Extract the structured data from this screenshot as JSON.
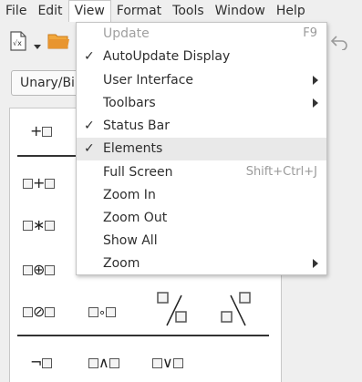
{
  "menubar": {
    "items": [
      {
        "label": "File"
      },
      {
        "label": "Edit"
      },
      {
        "label": "View"
      },
      {
        "label": "Format"
      },
      {
        "label": "Tools"
      },
      {
        "label": "Window"
      },
      {
        "label": "Help"
      }
    ]
  },
  "toolbar": {
    "icons": [
      "formula-document-icon",
      "dropdown-arrow-icon",
      "open-folder-icon",
      "undo-icon",
      "undo-dropdown-icon"
    ]
  },
  "elements_panel": {
    "category_combo_value": "Unary/Binary Operators",
    "symbols": {
      "unary_plus": "+",
      "plus": "+",
      "multiply": "∗",
      "circle_plus": "⊕",
      "circle_slash": "⊘",
      "ring": "∘",
      "not": "¬",
      "and": "∧",
      "or": "∨"
    }
  },
  "view_menu": {
    "items": [
      {
        "label": "Update",
        "shortcut": "F9",
        "checked": false,
        "enabled": false,
        "submenu": false
      },
      {
        "label": "AutoUpdate Display",
        "shortcut": "",
        "checked": true,
        "enabled": true,
        "submenu": false
      },
      {
        "label": "User Interface",
        "shortcut": "",
        "checked": false,
        "enabled": true,
        "submenu": true
      },
      {
        "label": "Toolbars",
        "shortcut": "",
        "checked": false,
        "enabled": true,
        "submenu": true
      },
      {
        "label": "Status Bar",
        "shortcut": "",
        "checked": true,
        "enabled": true,
        "submenu": false
      },
      {
        "label": "Elements",
        "shortcut": "",
        "checked": true,
        "enabled": true,
        "submenu": false,
        "highlighted": true
      },
      {
        "label": "Full Screen",
        "shortcut": "Shift+Ctrl+J",
        "checked": false,
        "enabled": true,
        "submenu": false
      },
      {
        "label": "Zoom In",
        "shortcut": "",
        "checked": false,
        "enabled": true,
        "submenu": false
      },
      {
        "label": "Zoom Out",
        "shortcut": "",
        "checked": false,
        "enabled": true,
        "submenu": false
      },
      {
        "label": "Show All",
        "shortcut": "",
        "checked": false,
        "enabled": true,
        "submenu": false
      },
      {
        "label": "Zoom",
        "shortcut": "",
        "checked": false,
        "enabled": true,
        "submenu": true
      }
    ],
    "check_glyph": "✓"
  },
  "colors": {
    "menu_highlight": "#e9e9e9",
    "disabled_text": "#a0a0a0",
    "folder_orange": "#e8952f"
  }
}
